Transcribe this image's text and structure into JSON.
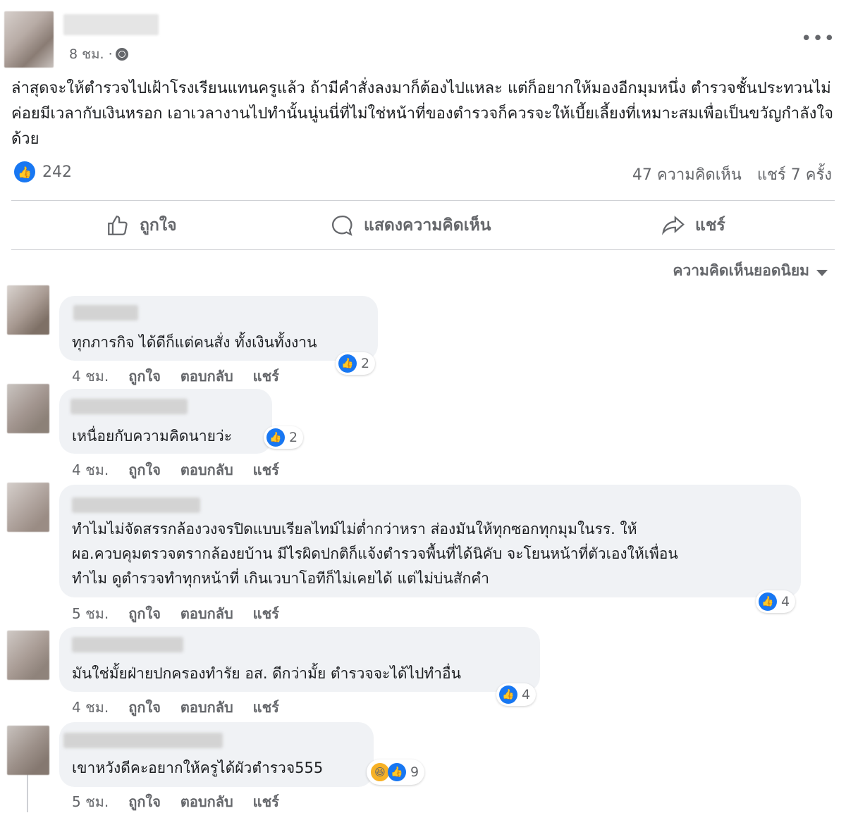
{
  "post": {
    "time": "8 ชม. ·",
    "text": "ล่าสุดจะให้ตำรวจไปเฝ้าโรงเรียนแทนครูแล้ว ถ้ามีคำสั่งลงมาก็ต้องไปแหละ แต่ก็อยากให้มองอีกมุมหนึ่ง ตำรวจชั้นประทวนไม่ค่อยมีเวลากับเงินหรอก เอาเวลางานไปทำนั้นนู่นนี่ที่ไม่ใช่หน้าที่ของตำรวจก็ควรจะให้เบี้ยเลี้ยงที่เหมาะสมเพื่อเป็นขวัญกำลังใจด้วย",
    "reaction_count": "242",
    "comment_count": "47 ความคิดเห็น",
    "share_count": "แชร์ 7 ครั้ง",
    "more_icon": "•••"
  },
  "actions": {
    "like": "ถูกใจ",
    "comment": "แสดงความคิดเห็น",
    "share": "แชร์"
  },
  "sort": {
    "label": "ความคิดเห็นยอดนิยม"
  },
  "comment_actions": {
    "like": "ถูกใจ",
    "reply": "ตอบกลับ",
    "share": "แชร์"
  },
  "comments": [
    {
      "text": "ทุกภารกิจ ได้ดีก็แต่คนสั่ง ทั้งเงินทั้งงาน",
      "time": "4 ชม.",
      "reactions": "2"
    },
    {
      "text": "เหนื่อยกับความคิดนายว่ะ",
      "time": "4 ชม.",
      "reactions": "2"
    },
    {
      "lines": [
        "ทำไมไม่จัดสรรกล้องวงจรปิดแบบเรียลไทม์ไม่ต่ำกว่าหรา ส่องมันให้ทุกซอกทุกมุมในรร. ให้",
        "ผอ.ควบคุมตรวจตรากล้องยบ้าน มีไรผิดปกติก็แจ้งตำรวจพื้นที่ได้นิคับ จะโยนหน้าที่ตัวเองให้เพื่อน",
        "ทำไม ดูตำรวจทำทุกหน้าที่ เกินเวบาโอทีก็ไม่เคยได้ แต่ไม่บ่นสักคำ"
      ],
      "time": "5 ชม.",
      "reactions": "4"
    },
    {
      "text": "มันใช่มั้ยฝ่ายปกครองทำรัย อส. ดีกว่ามั้ย ตำรวจจะได้ไปทำอื่น",
      "time": "4 ชม.",
      "reactions": "4"
    },
    {
      "text": "เขาหวังดีคะอยากให้ครูได้ผัวตำรวจ555",
      "time": "5 ชม.",
      "reactions": "9"
    }
  ],
  "colors": {
    "accent": "#1877f2",
    "bubble": "#f0f2f5",
    "muted": "#65676b"
  }
}
